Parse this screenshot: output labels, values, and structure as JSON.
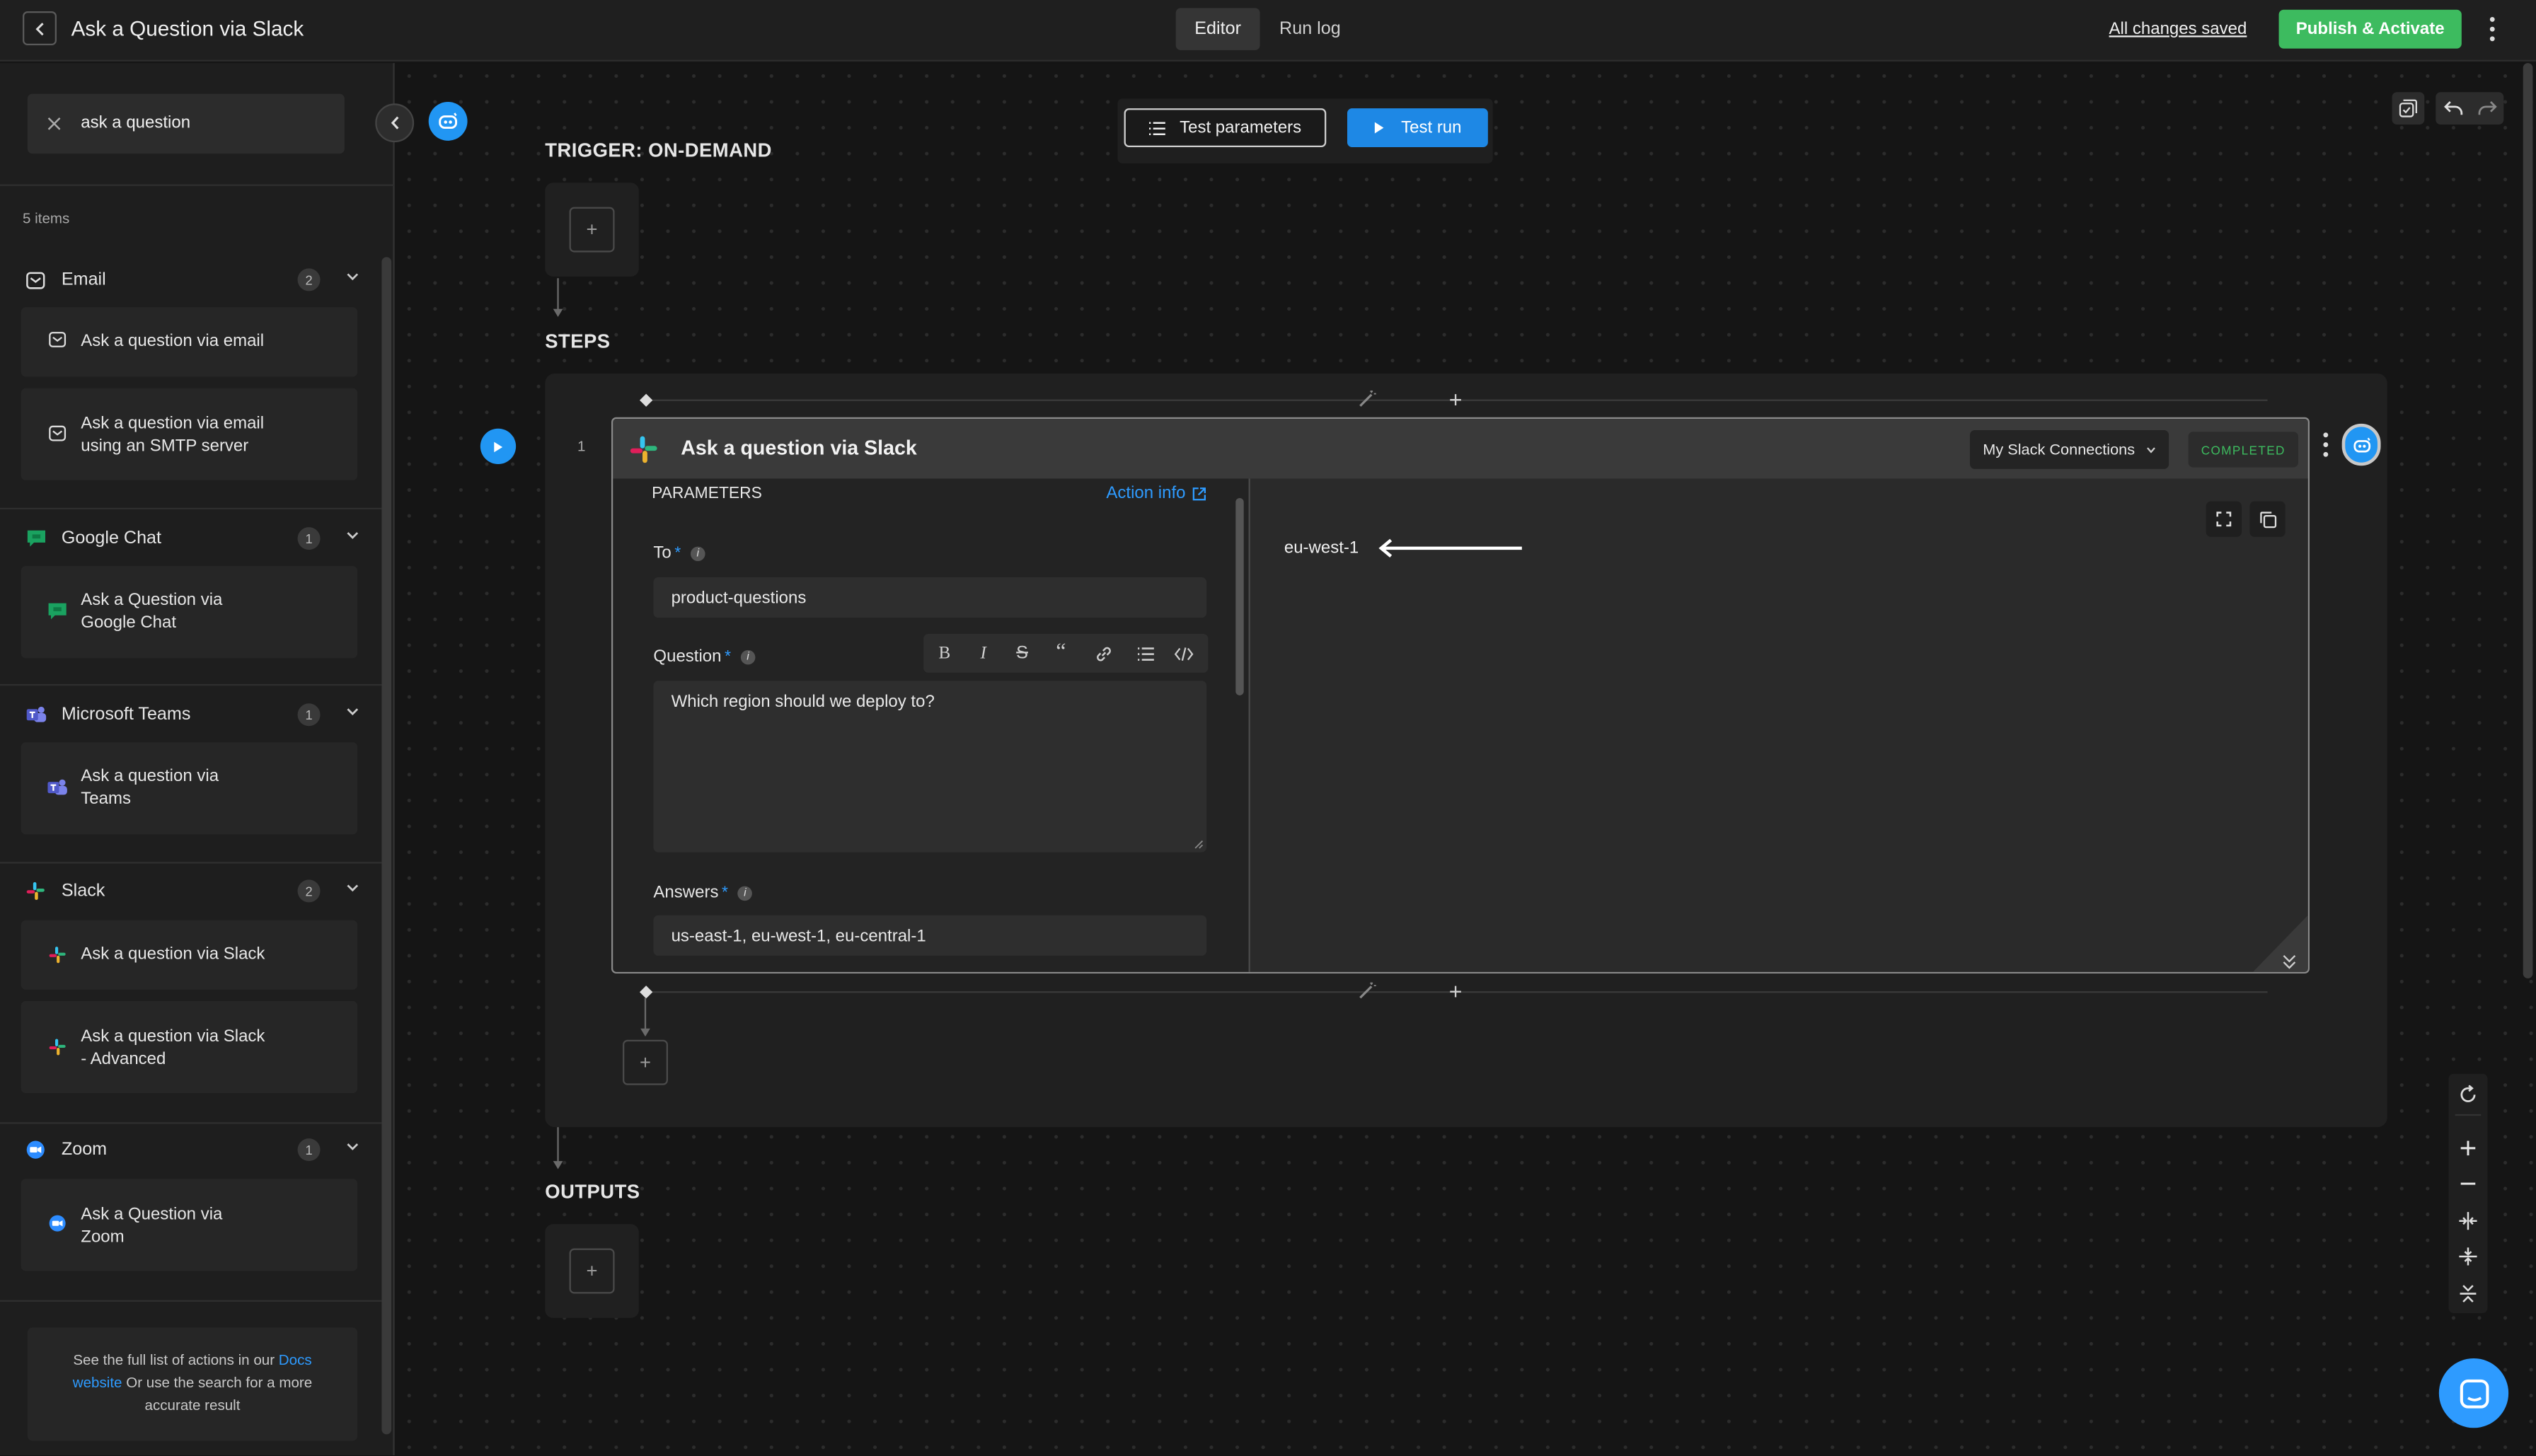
{
  "header": {
    "title": "Ask a Question via Slack",
    "tabs": [
      {
        "label": "Editor",
        "active": true
      },
      {
        "label": "Run log",
        "active": false
      }
    ],
    "save_status": "All changes saved",
    "publish_label": "Publish & Activate"
  },
  "sidebar": {
    "search_value": "ask a question",
    "count_label": "5 items",
    "categories": [
      {
        "name": "Email",
        "count": "2",
        "icon": "email-icon",
        "items": [
          "Ask a question via email",
          "Ask a question via email using an SMTP server"
        ]
      },
      {
        "name": "Google Chat",
        "count": "1",
        "icon": "google-chat-icon",
        "items": [
          "Ask a Question via Google Chat"
        ]
      },
      {
        "name": "Microsoft Teams",
        "count": "1",
        "icon": "teams-icon",
        "items": [
          "Ask a question via Teams"
        ]
      },
      {
        "name": "Slack",
        "count": "2",
        "icon": "slack-icon",
        "items": [
          "Ask a question via Slack",
          "Ask a question via Slack - Advanced"
        ]
      },
      {
        "name": "Zoom",
        "count": "1",
        "icon": "zoom-icon",
        "items": [
          "Ask a Question via Zoom"
        ]
      }
    ],
    "footer": {
      "before": "See the full list of actions in our ",
      "link": "Docs website",
      "after": " Or use the search for a more accurate result"
    }
  },
  "canvas": {
    "test_parameters_label": "Test parameters",
    "test_run_label": "Test run",
    "trigger_label": "TRIGGER: ON-DEMAND",
    "steps_label": "STEPS",
    "outputs_label": "OUTPUTS",
    "step": {
      "number": "1",
      "title": "Ask a question via Slack",
      "connection": "My Slack Connections",
      "status": "COMPLETED",
      "parameters_label": "PARAMETERS",
      "action_info_label": "Action info",
      "to_label": "To",
      "to_value": "product-questions",
      "question_label": "Question",
      "question_value": "Which region should we deploy to?",
      "answers_label": "Answers",
      "answers_value": "us-east-1, eu-west-1, eu-central-1",
      "output_value": "eu-west-1"
    }
  },
  "colors": {
    "accent": "#2e9bff",
    "publish": "#3dbb5f",
    "status_green": "#3dbb5f",
    "background": "#151515"
  }
}
